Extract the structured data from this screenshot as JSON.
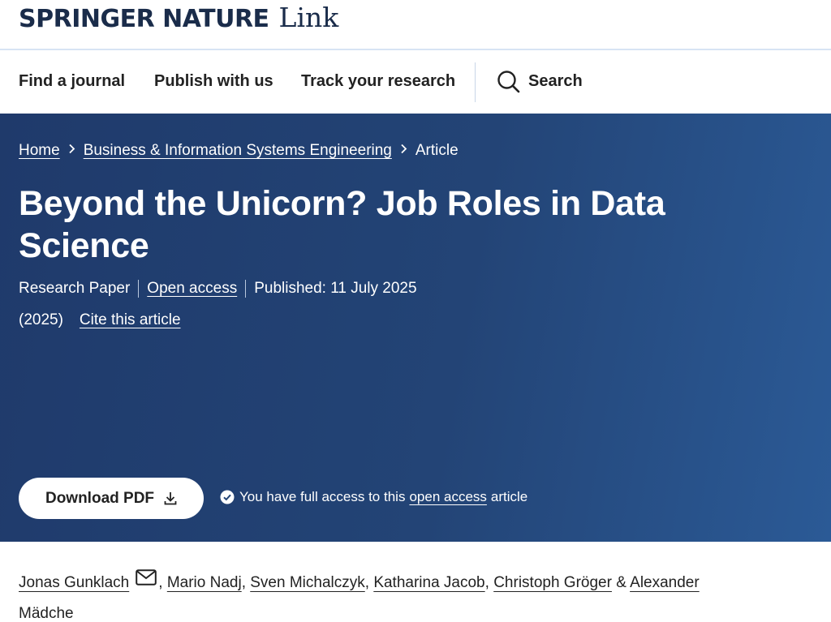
{
  "brand": {
    "name": "SPRINGER NATURE",
    "product": "Link"
  },
  "nav": {
    "items": [
      "Find a journal",
      "Publish with us",
      "Track your research"
    ],
    "search_label": "Search"
  },
  "breadcrumb": {
    "home": "Home",
    "journal": "Business & Information Systems Engineering",
    "current": "Article"
  },
  "article": {
    "title": "Beyond the Unicorn? Job Roles in Data Science",
    "type": "Research Paper",
    "open_access": "Open access",
    "published": "Published: 11 July 2025",
    "year": "(2025)",
    "cite": "Cite this article"
  },
  "actions": {
    "download_label": "Download PDF",
    "access_prefix": "You have full access to this",
    "access_link": "open access",
    "access_suffix": "article"
  },
  "authors": {
    "list": [
      "Jonas Gunklach",
      "Mario Nadj",
      "Sven Michalczyk",
      "Katharina Jacob",
      "Christoph Gröger",
      "Alexander Mädche"
    ],
    "and": "&"
  },
  "colors": {
    "hero_bg": "#234476",
    "brand": "#1a2c4a"
  }
}
